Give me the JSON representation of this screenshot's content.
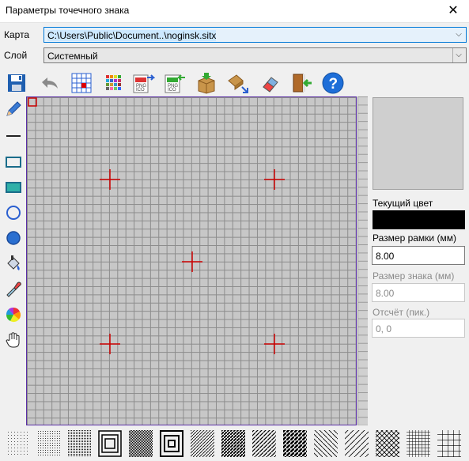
{
  "window": {
    "title": "Параметры точечного знака",
    "close_glyph": "✕"
  },
  "map": {
    "label": "Карта",
    "value": "C:\\Users\\Public\\Document..\\noginsk.sitx"
  },
  "layer": {
    "label": "Слой",
    "value": "Системный"
  },
  "toolbar": [
    "save-icon",
    "undo-icon",
    "grid-icon",
    "palette-icon",
    "export-icon",
    "import-icon",
    "box-icon",
    "scale-icon",
    "eraser-icon",
    "exit-icon",
    "help-icon"
  ],
  "tools": [
    "pencil-icon",
    "line-icon",
    "rect-outline-icon",
    "rect-filled-icon",
    "ellipse-outline-icon",
    "ellipse-filled-icon",
    "fill-icon",
    "eyedropper-icon",
    "color-wheel-icon",
    "hand-icon"
  ],
  "panel": {
    "current_color_label": "Текущий цвет",
    "current_color": "#000000",
    "frame_size_label": "Размер рамки (мм)",
    "frame_size": "8.00",
    "sign_size_label": "Размер знака (мм)",
    "sign_size": "8.00",
    "offset_label": "Отсчёт (пик.)",
    "offset": "0, 0"
  },
  "colors": {
    "grid_bg": "#c7c7c7",
    "cross": "#cc0000",
    "border": "#5a2ea6",
    "help": "#1e6ed8"
  },
  "patterns": [
    "dots-sparse",
    "dots-medium",
    "dots-dense",
    "squares-nested",
    "checker-dense",
    "squares-nested-2",
    "diagonal-fine",
    "diagonal-bold",
    "diagonal-medium",
    "diagonal-thick",
    "diagonal-thin",
    "diagonal-sparse",
    "diamond-grid",
    "square-grid",
    "square-grid-bold"
  ]
}
